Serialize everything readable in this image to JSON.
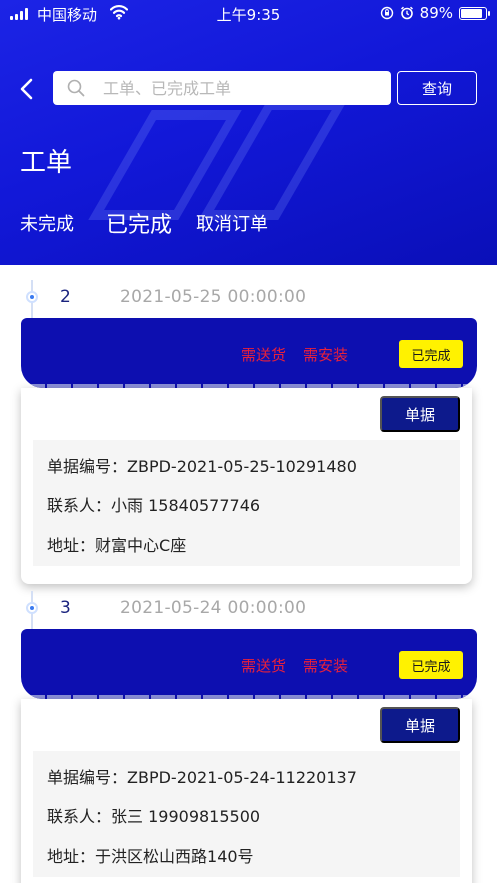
{
  "status_bar": {
    "carrier": "中国移动",
    "time": "上午9:35",
    "battery": "89%",
    "battery_level": 0.89
  },
  "header": {
    "search_placeholder": "工单、已完成工单",
    "query_label": "查询",
    "title": "工单",
    "tabs": [
      {
        "label": "未完成",
        "active": false
      },
      {
        "label": "已完成",
        "active": true
      },
      {
        "label": "取消订单",
        "active": false
      }
    ]
  },
  "orders": [
    {
      "index": "2",
      "date": "2021-05-25 00:00:00",
      "tags": [
        "需送货",
        "需安装"
      ],
      "status": "已完成",
      "receipt_label": "单据",
      "number_label": "单据编号：",
      "number": "ZBPD-2021-05-25-10291480",
      "contact_label": "联系人：",
      "contact": "小雨 15840577746",
      "address_label": "地址：",
      "address": "财富中心C座"
    },
    {
      "index": "3",
      "date": "2021-05-24 00:00:00",
      "tags": [
        "需送货",
        "需安装"
      ],
      "status": "已完成",
      "receipt_label": "单据",
      "number_label": "单据编号：",
      "number": "ZBPD-2021-05-24-11220137",
      "contact_label": "联系人：",
      "contact": "张三 19909815500",
      "address_label": "地址：",
      "address": "于洪区松山西路140号"
    }
  ],
  "colors": {
    "header_blue": "#1218d8",
    "bar_blue": "#0d0fb0",
    "button_blue": "#0d1a8c",
    "tag_red": "#e8213a",
    "badge_yellow": "#fff200"
  }
}
